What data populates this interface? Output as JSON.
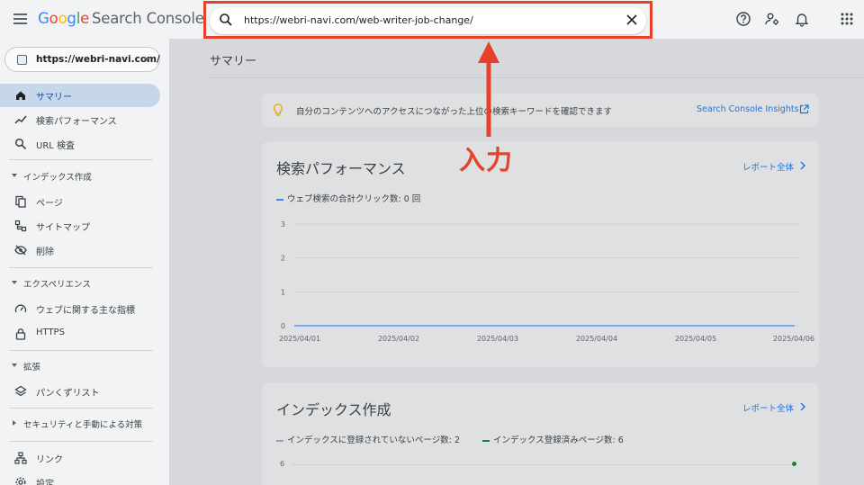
{
  "header": {
    "logo_google": [
      "G",
      "o",
      "o",
      "g",
      "l",
      "e"
    ],
    "logo_product": "Search Console",
    "search_value": "https://webri-navi.com/web-writer-job-change/",
    "icons": [
      "menu-icon",
      "search-icon",
      "close-icon",
      "help-icon",
      "manage-users-icon",
      "notifications-icon",
      "apps-icon"
    ]
  },
  "sidebar": {
    "property": "https://webri-navi.com/",
    "items": [
      {
        "label": "サマリー",
        "icon": "home-icon",
        "active": true
      },
      {
        "label": "検索パフォーマンス",
        "icon": "trending-icon"
      },
      {
        "label": "URL 検査",
        "icon": "search-icon"
      }
    ],
    "sections": [
      {
        "label": "インデックス作成",
        "items": [
          {
            "label": "ページ",
            "icon": "pages-icon"
          },
          {
            "label": "サイトマップ",
            "icon": "sitemap-icon"
          },
          {
            "label": "削除",
            "icon": "removal-icon"
          }
        ]
      },
      {
        "label": "エクスペリエンス",
        "items": [
          {
            "label": "ウェブに関する主な指標",
            "icon": "gauge-icon"
          },
          {
            "label": "HTTPS",
            "icon": "lock-icon"
          }
        ]
      },
      {
        "label": "拡張",
        "items": [
          {
            "label": "パンくずリスト",
            "icon": "layers-icon"
          }
        ]
      },
      {
        "label": "セキュリティと手動による対策",
        "collapsed": true,
        "items": []
      }
    ],
    "bottom_items": [
      {
        "label": "リンク",
        "icon": "links-icon"
      },
      {
        "label": "設定",
        "icon": "settings-icon"
      }
    ]
  },
  "main": {
    "page_title": "サマリー",
    "insight": {
      "text": "自分のコンテンツへのアクセスにつながった上位の検索キーワードを確認できます",
      "link": "Search Console Insights"
    },
    "performance": {
      "title": "検索パフォーマンス",
      "report_link": "レポート全体",
      "legend": "ウェブ検索の合計クリック数: 0 回"
    },
    "indexing": {
      "title": "インデックス作成",
      "report_link": "レポート全体",
      "legend_not_indexed": "インデックスに登録されていないページ数: 2",
      "legend_indexed": "インデックス登録済みページ数: 6",
      "y_tick_top": "6"
    }
  },
  "annotation": {
    "text": "入力",
    "color": "#e8412b"
  },
  "colors": {
    "accent": "#1a73e8",
    "clicks_series": "#4285f4",
    "not_indexed_series": "#9aa0a6",
    "indexed_series": "#188038",
    "annotation_red": "#e8412b"
  },
  "chart_data": [
    {
      "type": "line",
      "title": "",
      "x": [
        "2025/04/01",
        "2025/04/02",
        "2025/04/03",
        "2025/04/04",
        "2025/04/05",
        "2025/04/06"
      ],
      "yticks": [
        "0",
        "1",
        "2",
        "3"
      ],
      "ylim": [
        0,
        3
      ],
      "grid": true,
      "series": [
        {
          "name": "ウェブ検索の合計クリック数: 0 回",
          "color": "#4285f4",
          "values": [
            0,
            0,
            0,
            0,
            0,
            0
          ]
        }
      ]
    }
  ]
}
